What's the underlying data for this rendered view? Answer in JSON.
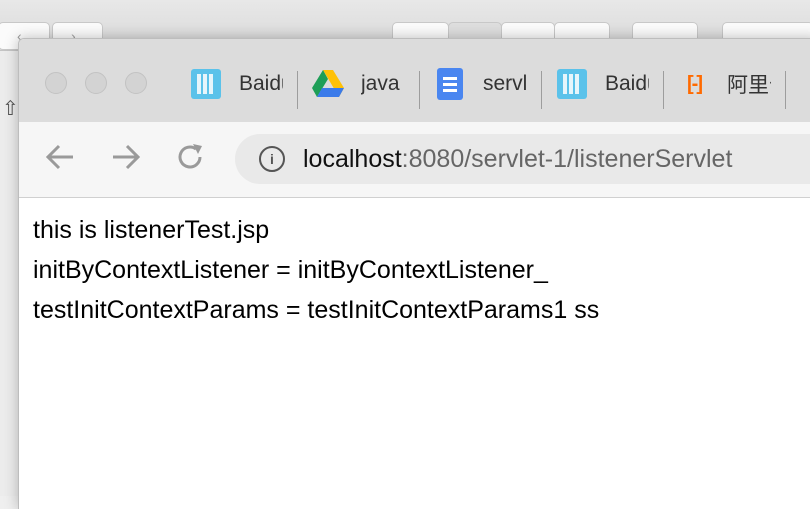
{
  "background_window": {
    "back_glyph": "‹",
    "forward_glyph": "›",
    "side_glyph": "⇧"
  },
  "browser": {
    "tabs": [
      {
        "favicon": "baidu-icon",
        "title": "Baidu"
      },
      {
        "favicon": "google-drive-icon",
        "title": "java"
      },
      {
        "favicon": "google-docs-icon",
        "title": "servlet"
      },
      {
        "favicon": "baidu-icon",
        "title": "Baidu"
      },
      {
        "favicon": "aliyun-icon",
        "title": "阿里云"
      }
    ],
    "address_bar": {
      "host": "localhost",
      "rest": ":8080/servlet-1/listenerServlet"
    }
  },
  "page": {
    "lines": [
      "this is listenerTest.jsp",
      "initByContextListener = initByContextListener_",
      "testInitContextParams = testInitContextParams1 ss"
    ]
  },
  "colors": {
    "ali_orange": "#ff6a00",
    "docs_blue": "#4a86f0",
    "baidu_blue": "#5bc2ea"
  }
}
